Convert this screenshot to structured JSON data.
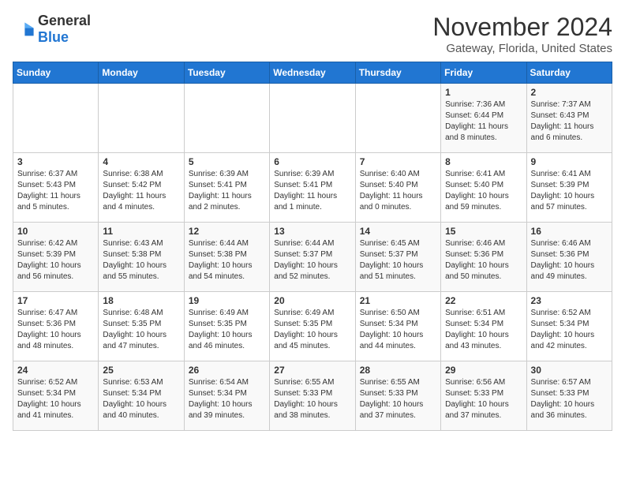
{
  "logo": {
    "general": "General",
    "blue": "Blue"
  },
  "title": "November 2024",
  "subtitle": "Gateway, Florida, United States",
  "days_of_week": [
    "Sunday",
    "Monday",
    "Tuesday",
    "Wednesday",
    "Thursday",
    "Friday",
    "Saturday"
  ],
  "weeks": [
    [
      {
        "day": "",
        "info": ""
      },
      {
        "day": "",
        "info": ""
      },
      {
        "day": "",
        "info": ""
      },
      {
        "day": "",
        "info": ""
      },
      {
        "day": "",
        "info": ""
      },
      {
        "day": "1",
        "info": "Sunrise: 7:36 AM\nSunset: 6:44 PM\nDaylight: 11 hours and 8 minutes."
      },
      {
        "day": "2",
        "info": "Sunrise: 7:37 AM\nSunset: 6:43 PM\nDaylight: 11 hours and 6 minutes."
      }
    ],
    [
      {
        "day": "3",
        "info": "Sunrise: 6:37 AM\nSunset: 5:43 PM\nDaylight: 11 hours and 5 minutes."
      },
      {
        "day": "4",
        "info": "Sunrise: 6:38 AM\nSunset: 5:42 PM\nDaylight: 11 hours and 4 minutes."
      },
      {
        "day": "5",
        "info": "Sunrise: 6:39 AM\nSunset: 5:41 PM\nDaylight: 11 hours and 2 minutes."
      },
      {
        "day": "6",
        "info": "Sunrise: 6:39 AM\nSunset: 5:41 PM\nDaylight: 11 hours and 1 minute."
      },
      {
        "day": "7",
        "info": "Sunrise: 6:40 AM\nSunset: 5:40 PM\nDaylight: 11 hours and 0 minutes."
      },
      {
        "day": "8",
        "info": "Sunrise: 6:41 AM\nSunset: 5:40 PM\nDaylight: 10 hours and 59 minutes."
      },
      {
        "day": "9",
        "info": "Sunrise: 6:41 AM\nSunset: 5:39 PM\nDaylight: 10 hours and 57 minutes."
      }
    ],
    [
      {
        "day": "10",
        "info": "Sunrise: 6:42 AM\nSunset: 5:39 PM\nDaylight: 10 hours and 56 minutes."
      },
      {
        "day": "11",
        "info": "Sunrise: 6:43 AM\nSunset: 5:38 PM\nDaylight: 10 hours and 55 minutes."
      },
      {
        "day": "12",
        "info": "Sunrise: 6:44 AM\nSunset: 5:38 PM\nDaylight: 10 hours and 54 minutes."
      },
      {
        "day": "13",
        "info": "Sunrise: 6:44 AM\nSunset: 5:37 PM\nDaylight: 10 hours and 52 minutes."
      },
      {
        "day": "14",
        "info": "Sunrise: 6:45 AM\nSunset: 5:37 PM\nDaylight: 10 hours and 51 minutes."
      },
      {
        "day": "15",
        "info": "Sunrise: 6:46 AM\nSunset: 5:36 PM\nDaylight: 10 hours and 50 minutes."
      },
      {
        "day": "16",
        "info": "Sunrise: 6:46 AM\nSunset: 5:36 PM\nDaylight: 10 hours and 49 minutes."
      }
    ],
    [
      {
        "day": "17",
        "info": "Sunrise: 6:47 AM\nSunset: 5:36 PM\nDaylight: 10 hours and 48 minutes."
      },
      {
        "day": "18",
        "info": "Sunrise: 6:48 AM\nSunset: 5:35 PM\nDaylight: 10 hours and 47 minutes."
      },
      {
        "day": "19",
        "info": "Sunrise: 6:49 AM\nSunset: 5:35 PM\nDaylight: 10 hours and 46 minutes."
      },
      {
        "day": "20",
        "info": "Sunrise: 6:49 AM\nSunset: 5:35 PM\nDaylight: 10 hours and 45 minutes."
      },
      {
        "day": "21",
        "info": "Sunrise: 6:50 AM\nSunset: 5:34 PM\nDaylight: 10 hours and 44 minutes."
      },
      {
        "day": "22",
        "info": "Sunrise: 6:51 AM\nSunset: 5:34 PM\nDaylight: 10 hours and 43 minutes."
      },
      {
        "day": "23",
        "info": "Sunrise: 6:52 AM\nSunset: 5:34 PM\nDaylight: 10 hours and 42 minutes."
      }
    ],
    [
      {
        "day": "24",
        "info": "Sunrise: 6:52 AM\nSunset: 5:34 PM\nDaylight: 10 hours and 41 minutes."
      },
      {
        "day": "25",
        "info": "Sunrise: 6:53 AM\nSunset: 5:34 PM\nDaylight: 10 hours and 40 minutes."
      },
      {
        "day": "26",
        "info": "Sunrise: 6:54 AM\nSunset: 5:34 PM\nDaylight: 10 hours and 39 minutes."
      },
      {
        "day": "27",
        "info": "Sunrise: 6:55 AM\nSunset: 5:33 PM\nDaylight: 10 hours and 38 minutes."
      },
      {
        "day": "28",
        "info": "Sunrise: 6:55 AM\nSunset: 5:33 PM\nDaylight: 10 hours and 37 minutes."
      },
      {
        "day": "29",
        "info": "Sunrise: 6:56 AM\nSunset: 5:33 PM\nDaylight: 10 hours and 37 minutes."
      },
      {
        "day": "30",
        "info": "Sunrise: 6:57 AM\nSunset: 5:33 PM\nDaylight: 10 hours and 36 minutes."
      }
    ]
  ]
}
